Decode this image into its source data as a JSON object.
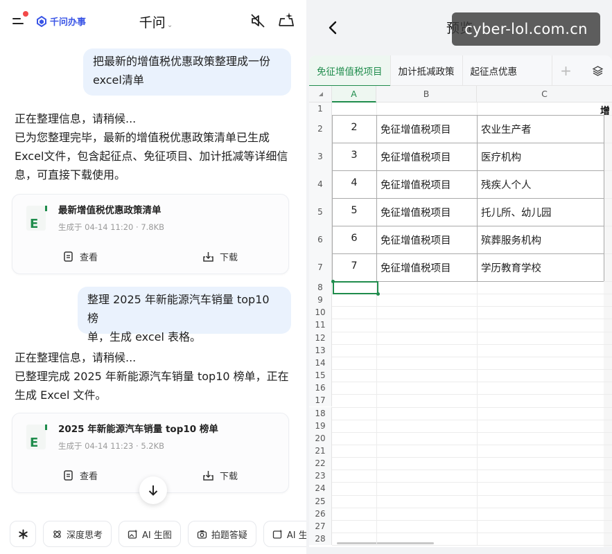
{
  "left": {
    "brand": "千问办事",
    "title": "千问",
    "messages": [
      {
        "role": "user",
        "lines": [
          "把最新的增值税优惠政策整理成一份",
          "excel清单"
        ]
      },
      {
        "role": "assistant",
        "lines": [
          "正在整理信息，请稍候...",
          "已为您整理完毕，最新的增值税优惠政策清单已生成Excel文件，包含起征点、免征项目、加计抵减等详细信息，可直接下载使用。"
        ]
      },
      {
        "role": "user",
        "lines": [
          "整理 2025 年新能源汽车销量 top10 榜",
          "单，生成 excel 表格。"
        ]
      },
      {
        "role": "assistant",
        "lines": [
          "正在整理信息，请稍候...",
          "已整理完成 2025 年新能源汽车销量 top10 榜单，正在生成 Excel 文件。"
        ]
      }
    ],
    "files": [
      {
        "name": "最新增值税优惠政策清单",
        "meta": "生成于 04-14 11:20 · 7.8KB",
        "view": "查看",
        "download": "下载"
      },
      {
        "name": "2025 年新能源汽车销量 top10 榜单",
        "meta": "生成于 04-14 11:23 · 5.2KB",
        "view": "查看",
        "download": "下载"
      }
    ],
    "chips": [
      "深度思考",
      "AI 生图",
      "拍题答疑",
      "AI 生"
    ]
  },
  "right": {
    "title": "预览",
    "watermark": "cyber-lol.com.cn",
    "tabs": [
      "免征增值税项目",
      "加计抵减政策",
      "起征点优惠"
    ],
    "active_tab": 0,
    "columns": [
      "A",
      "B",
      "C"
    ],
    "header_partial": "增",
    "row_numbers": [
      "1",
      "2",
      "3",
      "4",
      "5",
      "6",
      "7",
      "8",
      "9",
      "10",
      "11",
      "12",
      "13",
      "14",
      "15",
      "16",
      "17",
      "18",
      "19",
      "20",
      "21",
      "22",
      "23",
      "24",
      "25",
      "26",
      "27",
      "28"
    ],
    "rows": [
      {
        "a": "2",
        "b": "免征增值税项目",
        "c": "农业生产者"
      },
      {
        "a": "3",
        "b": "免征增值税项目",
        "c": "医疗机构"
      },
      {
        "a": "4",
        "b": "免征增值税项目",
        "c": "残疾人个人"
      },
      {
        "a": "5",
        "b": "免征增值税项目",
        "c": "托儿所、幼儿园"
      },
      {
        "a": "6",
        "b": "免征增值税项目",
        "c": "殡葬服务机构"
      },
      {
        "a": "7",
        "b": "免征增值税项目",
        "c": "学历教育学校"
      }
    ]
  },
  "colors": {
    "accent_green": "#1f8c4c",
    "brand_blue": "#3a55e6",
    "bubble": "#eaf2fd",
    "notify_red": "#f24949"
  }
}
